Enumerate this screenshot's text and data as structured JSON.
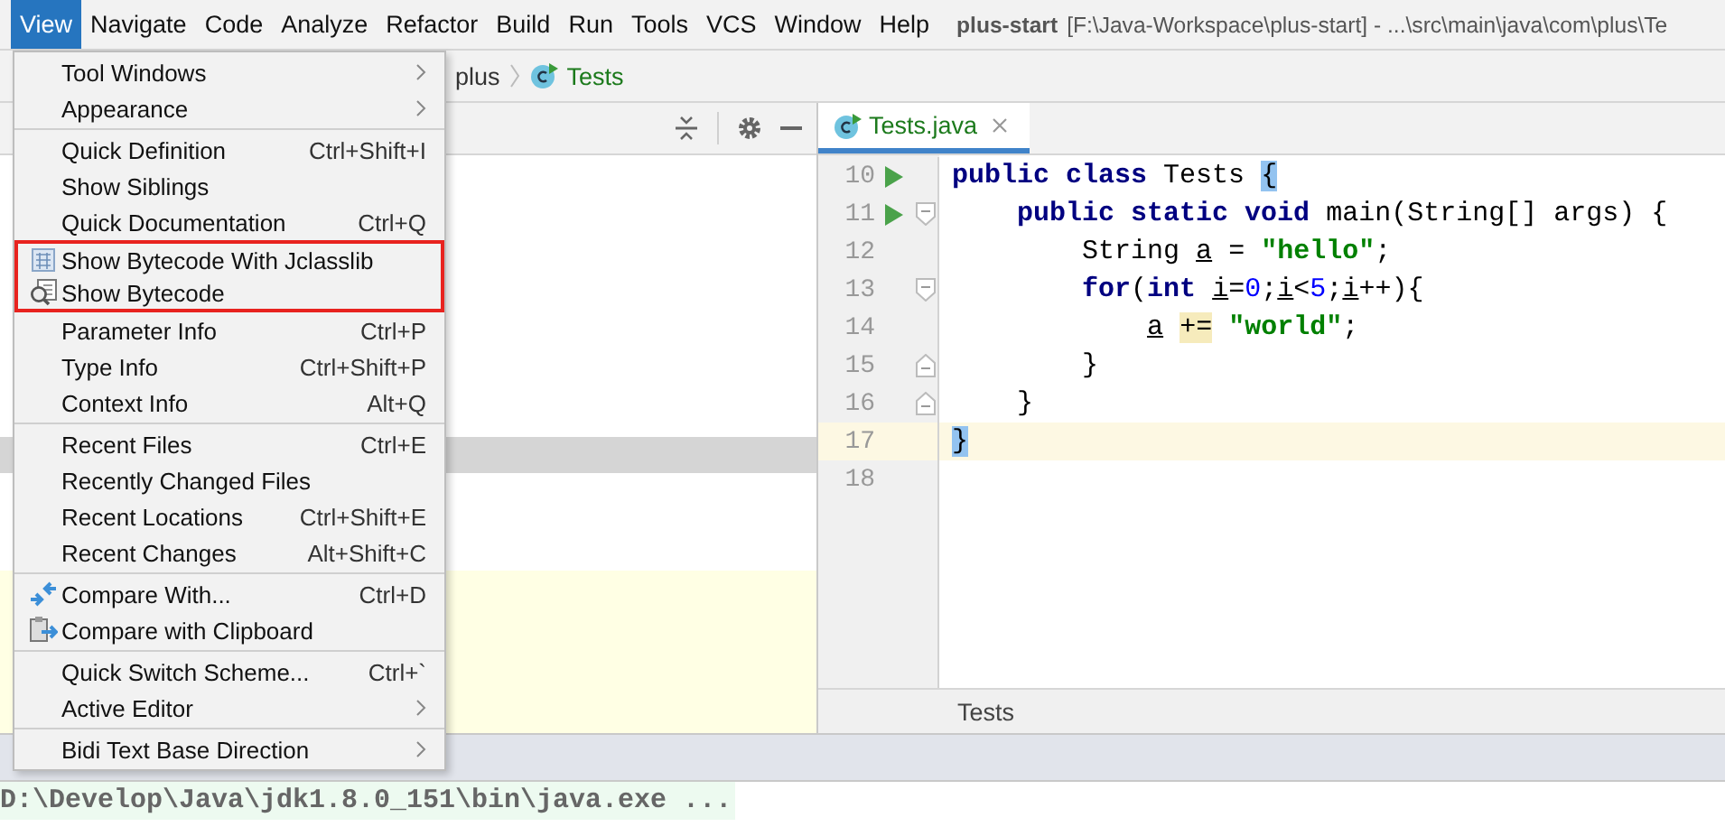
{
  "menu_bar": {
    "items": [
      {
        "label": "View",
        "selected": true
      },
      {
        "label": "Navigate",
        "selected": false
      },
      {
        "label": "Code",
        "selected": false
      },
      {
        "label": "Analyze",
        "selected": false
      },
      {
        "label": "Refactor",
        "selected": false
      },
      {
        "label": "Build",
        "selected": false
      },
      {
        "label": "Run",
        "selected": false
      },
      {
        "label": "Tools",
        "selected": false
      },
      {
        "label": "VCS",
        "selected": false
      },
      {
        "label": "Window",
        "selected": false
      },
      {
        "label": "Help",
        "selected": false
      }
    ],
    "project": "plus-start",
    "path": "[F:\\Java-Workspace\\plus-start] - ...\\src\\main\\java\\com\\plus\\Te"
  },
  "breadcrumbs": [
    {
      "label": "plus",
      "kind": "package"
    },
    {
      "label": "Tests",
      "kind": "class"
    }
  ],
  "view_menu": {
    "sections": [
      [
        {
          "label": "Tool Windows",
          "submenu": true,
          "outlined": false
        },
        {
          "label": "Appearance",
          "submenu": true,
          "outlined": false
        }
      ],
      [
        {
          "label": "Quick Definition",
          "shortcut": "Ctrl+Shift+I",
          "submenu": false,
          "outlined": false
        },
        {
          "label": "Show Siblings",
          "submenu": false,
          "outlined": false
        },
        {
          "label": "Quick Documentation",
          "shortcut": "Ctrl+Q",
          "submenu": false,
          "outlined": false
        },
        {
          "label": "Show Bytecode With Jclasslib",
          "kind": "jclasslib",
          "submenu": false,
          "outlined": true
        },
        {
          "label": "Show Bytecode",
          "kind": "bytecode",
          "submenu": false,
          "outlined": true
        },
        {
          "label": "Parameter Info",
          "shortcut": "Ctrl+P",
          "submenu": false,
          "outlined": false
        },
        {
          "label": "Type Info",
          "shortcut": "Ctrl+Shift+P",
          "submenu": false,
          "outlined": false
        },
        {
          "label": "Context Info",
          "shortcut": "Alt+Q",
          "submenu": false,
          "outlined": false
        }
      ],
      [
        {
          "label": "Recent Files",
          "shortcut": "Ctrl+E",
          "submenu": false,
          "outlined": false
        },
        {
          "label": "Recently Changed Files",
          "submenu": false,
          "outlined": false
        },
        {
          "label": "Recent Locations",
          "shortcut": "Ctrl+Shift+E",
          "submenu": false,
          "outlined": false
        },
        {
          "label": "Recent Changes",
          "shortcut": "Alt+Shift+C",
          "submenu": false,
          "outlined": false
        }
      ],
      [
        {
          "label": "Compare With...",
          "kind": "compare",
          "shortcut": "Ctrl+D",
          "submenu": false,
          "outlined": false
        },
        {
          "label": "Compare with Clipboard",
          "kind": "clipboard",
          "submenu": false,
          "outlined": false
        }
      ],
      [
        {
          "label": "Quick Switch Scheme...",
          "shortcut": "Ctrl+`",
          "submenu": false,
          "outlined": false
        },
        {
          "label": "Active Editor",
          "submenu": true,
          "outlined": false
        }
      ],
      [
        {
          "label": "Bidi Text Base Direction",
          "submenu": true,
          "outlined": false
        }
      ]
    ]
  },
  "editor": {
    "tab": {
      "label": "Tests.java",
      "selected": true
    },
    "lines": [
      {
        "number": "10",
        "run": true,
        "fold_open": false,
        "fold_close": false,
        "current": false,
        "tokens": [
          {
            "t": "public class",
            "kind": "kw"
          },
          {
            "t": " Tests",
            "kind": "plain"
          },
          {
            "t": " {",
            "kind": "match"
          }
        ]
      },
      {
        "number": "11",
        "run": true,
        "fold_open": true,
        "fold_close": false,
        "current": false,
        "tokens": [
          {
            "t": "    public static void",
            "kind": "kw"
          },
          {
            "t": " main(String[] args) {",
            "kind": "plain"
          }
        ]
      },
      {
        "number": "12",
        "run": false,
        "fold_open": false,
        "fold_close": false,
        "current": false,
        "tokens": [
          {
            "t": "        String",
            "kind": "plain"
          },
          {
            "t": " a",
            "kind": "var"
          },
          {
            "t": " =",
            "kind": "plain"
          },
          {
            "t": " \"hello\"",
            "kind": "str"
          },
          {
            "t": ";",
            "kind": "plain"
          }
        ]
      },
      {
        "number": "13",
        "run": false,
        "fold_open": true,
        "fold_close": false,
        "current": false,
        "tokens": [
          {
            "t": "        for",
            "kind": "kw"
          },
          {
            "t": "(",
            "kind": "plain"
          },
          {
            "t": "int",
            "kind": "kw"
          },
          {
            "t": " i",
            "kind": "var"
          },
          {
            "t": "=",
            "kind": "plain"
          },
          {
            "t": "0",
            "kind": "num"
          },
          {
            "t": ";",
            "kind": "plain"
          },
          {
            "t": "i",
            "kind": "var"
          },
          {
            "t": "<",
            "kind": "plain"
          },
          {
            "t": "5",
            "kind": "num"
          },
          {
            "t": ";",
            "kind": "plain"
          },
          {
            "t": "i",
            "kind": "var"
          },
          {
            "t": "++){",
            "kind": "plain"
          }
        ]
      },
      {
        "number": "14",
        "run": false,
        "fold_open": false,
        "fold_close": false,
        "current": false,
        "tokens": [
          {
            "t": "            a",
            "kind": "var"
          },
          {
            "t": " +=",
            "kind": "hl"
          },
          {
            "t": " \"world\"",
            "kind": "str"
          },
          {
            "t": ";",
            "kind": "plain"
          }
        ]
      },
      {
        "number": "15",
        "run": false,
        "fold_open": false,
        "fold_close": true,
        "current": false,
        "tokens": [
          {
            "t": "        }",
            "kind": "plain"
          }
        ]
      },
      {
        "number": "16",
        "run": false,
        "fold_open": false,
        "fold_close": true,
        "current": false,
        "tokens": [
          {
            "t": "    }",
            "kind": "plain"
          }
        ]
      },
      {
        "number": "17",
        "run": false,
        "fold_open": false,
        "fold_close": false,
        "current": true,
        "tokens": [
          {
            "t": "}",
            "kind": "match"
          }
        ]
      },
      {
        "number": "18",
        "run": false,
        "fold_open": false,
        "fold_close": false,
        "current": false
      }
    ],
    "breadcrumb": "Tests"
  },
  "console": {
    "line": "D:\\Develop\\Java\\jdk1.8.0_151\\bin\\java.exe ..."
  }
}
